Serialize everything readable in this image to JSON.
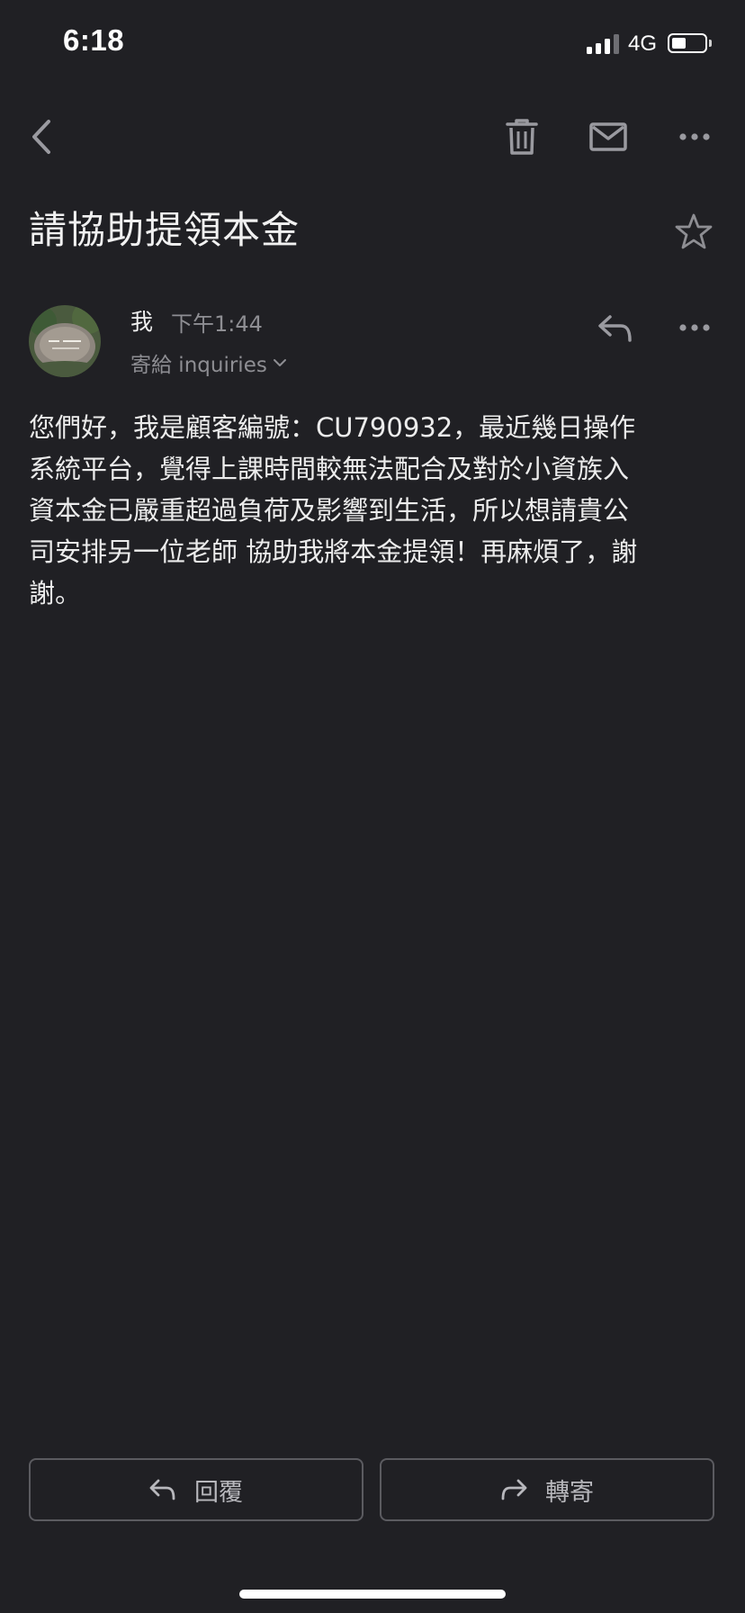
{
  "status_bar": {
    "time": "6:18",
    "network": "4G",
    "battery_level": 0.45,
    "signal_bars": 3
  },
  "toolbar": {
    "back_icon": "chevron-left-icon",
    "delete_icon": "trash-icon",
    "mark_icon": "mail-icon",
    "more_icon": "more-horizontal-icon"
  },
  "email": {
    "subject": "請協助提領本金",
    "sender": "我",
    "time": "下午1:44",
    "recipient": "寄給 inquiries",
    "body": "您們好，我是顧客編號：CU790932，最近幾日操作\n系統平台，覺得上課時間較無法配合及對於小資族入\n資本金已嚴重超過負荷及影響到生活，所以想請貴公\n司安排另一位老師 協助我將本金提領！再麻煩了，謝\n謝。"
  },
  "actions": {
    "reply_label": "回覆",
    "forward_label": "轉寄"
  },
  "colors": {
    "background": "#202024",
    "icon": "#9a9aa0",
    "text": "#ececec",
    "muted": "#8e8e93"
  }
}
